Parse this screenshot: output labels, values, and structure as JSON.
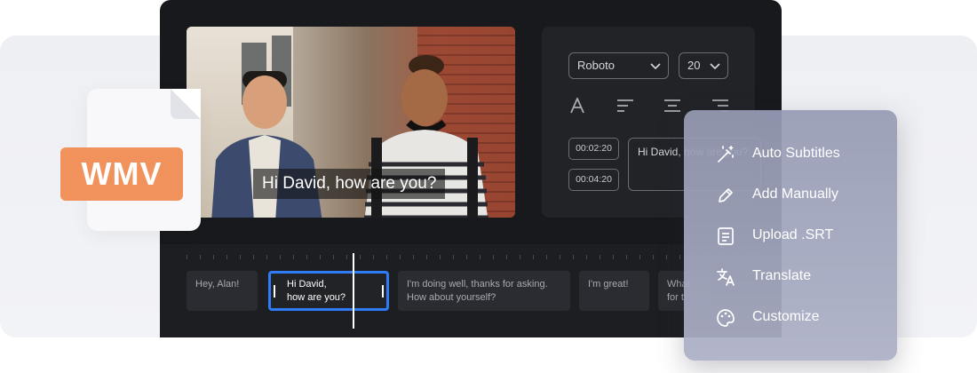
{
  "file_badge": {
    "label": "WMV",
    "color": "#f1915b"
  },
  "preview": {
    "caption": "Hi David, how are you?"
  },
  "style_panel": {
    "font_select": "Roboto",
    "size_select": "20",
    "timestamps": [
      "00:02:20",
      "00:04:20"
    ],
    "subtitle_text": "Hi David, how are you?"
  },
  "timeline": {
    "clips": [
      {
        "text": "Hey, Alan!"
      },
      {
        "text": "Hi David,\nhow are you?",
        "active": true
      },
      {
        "text": "I'm doing well, thanks for asking.\nHow about yourself?"
      },
      {
        "text": "I'm great!"
      },
      {
        "text": "What\nfor t"
      }
    ],
    "accent": "#2f7cf6"
  },
  "menu": {
    "items": [
      {
        "label": "Auto Subtitles",
        "icon": "magic-wand-icon"
      },
      {
        "label": "Add Manually",
        "icon": "pencil-icon"
      },
      {
        "label": "Upload .SRT",
        "icon": "document-icon"
      },
      {
        "label": "Translate",
        "icon": "translate-icon"
      },
      {
        "label": "Customize",
        "icon": "palette-icon"
      }
    ]
  }
}
